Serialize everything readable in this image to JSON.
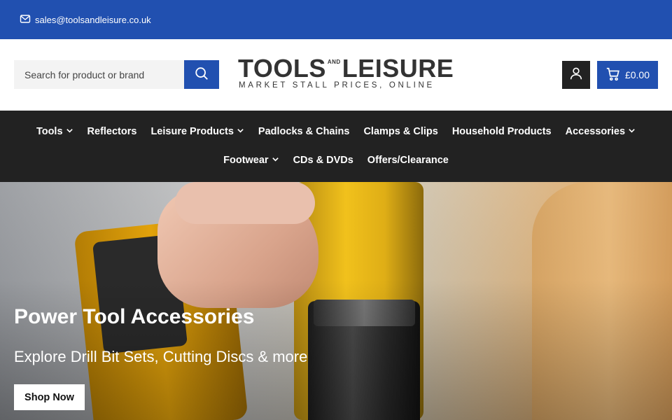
{
  "topbar": {
    "email": "sales@toolsandleisure.co.uk"
  },
  "search": {
    "placeholder": "Search for product or brand"
  },
  "logo": {
    "part1": "TOOLS",
    "and_line1": "AND",
    "part2": "LEISURE",
    "tagline": "MARKET STALL PRICES, ONLINE"
  },
  "cart": {
    "total": "£0.00"
  },
  "nav": {
    "row1": [
      {
        "label": "Tools",
        "dropdown": true
      },
      {
        "label": "Reflectors",
        "dropdown": false
      },
      {
        "label": "Leisure Products",
        "dropdown": true
      },
      {
        "label": "Padlocks & Chains",
        "dropdown": false
      },
      {
        "label": "Clamps & Clips",
        "dropdown": false
      },
      {
        "label": "Household Products",
        "dropdown": false
      },
      {
        "label": "Accessories",
        "dropdown": true
      }
    ],
    "row2": [
      {
        "label": "Footwear",
        "dropdown": true
      },
      {
        "label": "CDs & DVDs",
        "dropdown": false
      },
      {
        "label": "Offers/Clearance",
        "dropdown": false
      }
    ]
  },
  "hero": {
    "title": "Power Tool Accessories",
    "subtitle": "Explore Drill Bit Sets, Cutting Discs & more",
    "cta": "Shop Now"
  },
  "colors": {
    "brand_blue": "#2150b0",
    "nav_dark": "#222222"
  }
}
